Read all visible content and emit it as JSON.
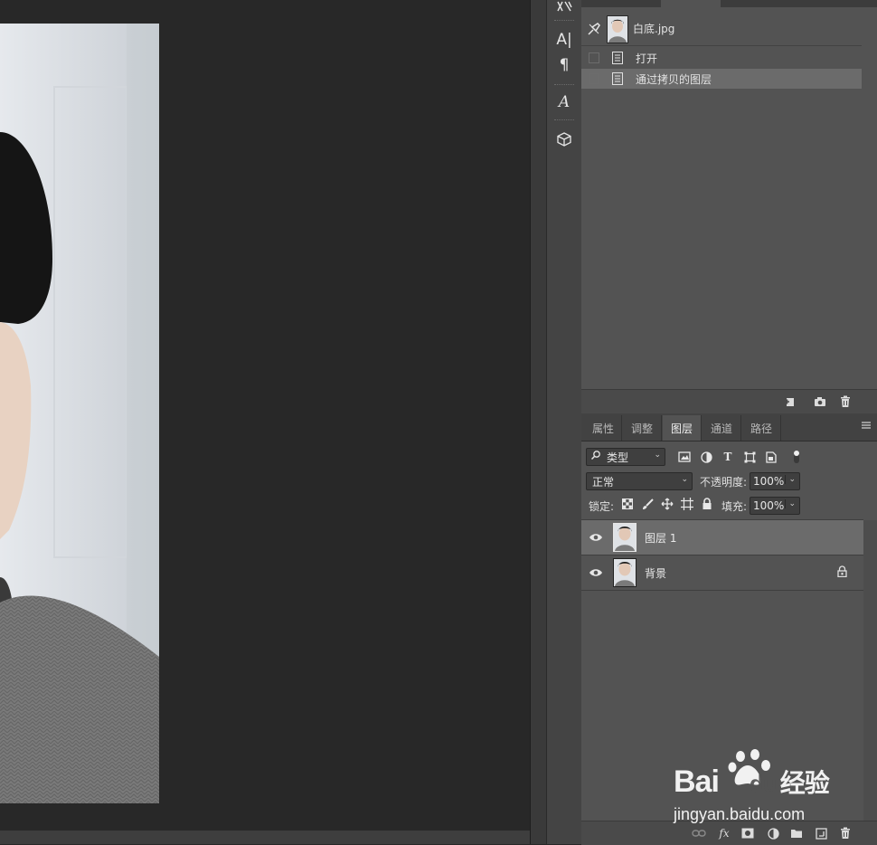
{
  "colors": {
    "panel": "#535353",
    "panel_dark": "#424242",
    "selected_row": "#6b6b6b",
    "canvas_bg": "#282828"
  },
  "tool_strip": {
    "icons": [
      "character-paragraph-icon",
      "character-icon",
      "paragraph-icon",
      "glyphs-icon",
      "3d-icon"
    ],
    "character_glyph": "A|",
    "paragraph_glyph": "¶",
    "glyphs_glyph": "A"
  },
  "history": {
    "snapshot_name": "白底.jpg",
    "items": [
      {
        "label": "打开",
        "selected": false
      },
      {
        "label": "通过拷贝的图层",
        "selected": true
      }
    ],
    "footer_icons": [
      "new-document-icon",
      "snapshot-camera-icon",
      "trash-icon"
    ]
  },
  "layers_panel": {
    "tabs": [
      "属性",
      "调整",
      "图层",
      "通道",
      "路径"
    ],
    "active_tab": "图层",
    "filter": {
      "label": "类型",
      "icons": [
        "image-filter-icon",
        "adjustment-filter-icon",
        "type-filter-icon",
        "shape-filter-icon",
        "smart-object-filter-icon",
        "filter-toggle-icon"
      ]
    },
    "blend_mode": "正常",
    "opacity_label": "不透明度:",
    "opacity_value": "100%",
    "lock_label": "锁定:",
    "lock_icons": [
      "lock-transparent-icon",
      "lock-paint-icon",
      "lock-position-icon",
      "lock-artboard-icon",
      "lock-all-icon"
    ],
    "fill_label": "填充:",
    "fill_value": "100%",
    "layers": [
      {
        "name": "图层 1",
        "visible": true,
        "selected": true,
        "locked": false
      },
      {
        "name": "背景",
        "visible": true,
        "selected": false,
        "locked": true
      }
    ],
    "footer_icons": [
      "link-icon",
      "fx-icon",
      "mask-icon",
      "adjustment-layer-icon",
      "group-folder-icon",
      "new-layer-icon",
      "trash-icon"
    ],
    "fx_label": "fx"
  },
  "watermark": {
    "brand": "Bai",
    "brand_tail": "du",
    "product": "经验",
    "url": "jingyan.baidu.com"
  }
}
